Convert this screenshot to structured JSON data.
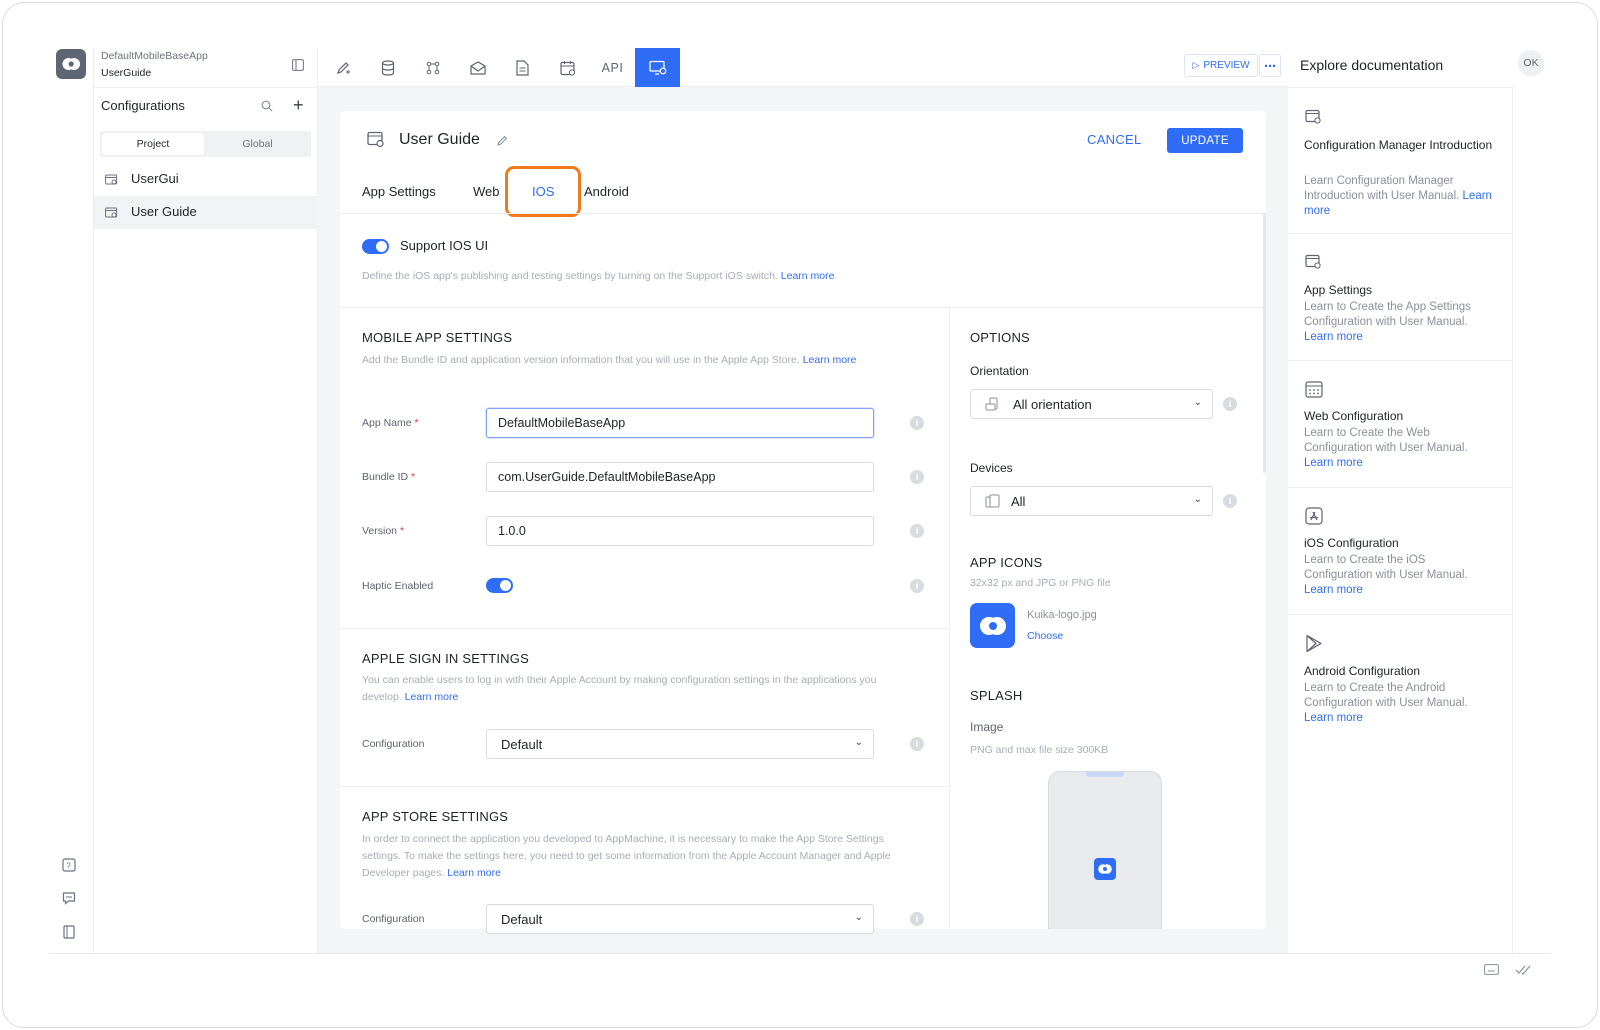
{
  "app": {
    "name": "DefaultMobileBaseApp",
    "project": "UserGuide"
  },
  "sidebar": {
    "title": "Configurations",
    "scope_tabs": [
      "Project",
      "Global"
    ],
    "items": [
      {
        "label": "UserGui",
        "selected": false
      },
      {
        "label": "User Guide",
        "selected": true
      }
    ]
  },
  "toolbar": {
    "api_label": "API",
    "preview_label": "PREVIEW"
  },
  "header": {
    "title": "User Guide",
    "cancel_label": "CANCEL",
    "update_label": "UPDATE"
  },
  "tabs": [
    {
      "label": "App Settings",
      "active": false
    },
    {
      "label": "Web",
      "active": false
    },
    {
      "label": "IOS",
      "active": true
    },
    {
      "label": "Android",
      "active": false
    }
  ],
  "support_ios": {
    "label": "Support IOS UI",
    "enabled": true,
    "hint": "Define the iOS app's publishing and testing settings by turning on the Support iOS switch.",
    "link": "Learn more"
  },
  "mobile_app_settings": {
    "title": "MOBILE APP SETTINGS",
    "hint": "Add the Bundle ID and application version information that you will use in the Apple App Store.",
    "link": "Learn more",
    "fields": {
      "app_name": {
        "label": "App Name",
        "value": "DefaultMobileBaseApp"
      },
      "bundle_id": {
        "label": "Bundle ID",
        "value": "com.UserGuide.DefaultMobileBaseApp"
      },
      "version": {
        "label": "Version",
        "value": "1.0.0"
      },
      "haptic": {
        "label": "Haptic Enabled",
        "enabled": true
      }
    }
  },
  "apple_sign_in": {
    "title": "APPLE SIGN IN SETTINGS",
    "hint": "You can enable users to log in with their Apple Account by making configuration settings in the applications you develop.",
    "link": "Learn more",
    "config_label": "Configuration",
    "config_value": "Default"
  },
  "app_store": {
    "title": "APP STORE SETTINGS",
    "hint": "In order to connect the application you developed to AppMachine, it is necessary to make the App Store Settings settings. To make the settings here, you need to get some information from the Apple Account Manager and Apple Developer pages.",
    "link": "Learn more",
    "config_label": "Configuration",
    "config_value": "Default"
  },
  "options": {
    "title": "OPTIONS",
    "orientation_label": "Orientation",
    "orientation_value": "All orientation",
    "devices_label": "Devices",
    "devices_value": "All"
  },
  "app_icons": {
    "title": "APP ICONS",
    "hint": "32x32 px and JPG or PNG file",
    "file_name": "Kuika-logo.jpg",
    "choose_label": "Choose"
  },
  "splash": {
    "title": "SPLASH",
    "image_label": "Image",
    "hint": "PNG and max file size 300KB"
  },
  "docs": {
    "title": "Explore documentation",
    "user_initials": "OK",
    "items": [
      {
        "title": "Configuration Manager Introduction",
        "text": "Learn Configuration Manager Introduction with User Manual.",
        "link": "Learn more"
      },
      {
        "title": "App Settings",
        "text": "Learn to Create the App Settings Configuration with User Manual.",
        "link": "Learn more"
      },
      {
        "title": "Web Configuration",
        "text": "Learn to Create the Web Configuration with User Manual.",
        "link": "Learn more"
      },
      {
        "title": "iOS Configuration",
        "text": "Learn to Create the iOS Configuration with User Manual.",
        "link": "Learn more"
      },
      {
        "title": "Android Configuration",
        "text": "Learn to Create the Android Configuration with User Manual.",
        "link": "Learn more"
      }
    ]
  },
  "colors": {
    "accent": "#2f6df6",
    "highlight": "#f07a1a",
    "required": "#e03b3b"
  }
}
